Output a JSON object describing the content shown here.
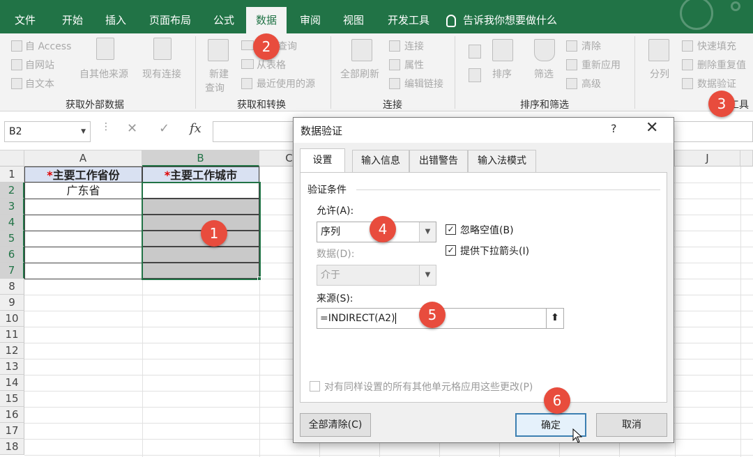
{
  "tabs": [
    "文件",
    "开始",
    "插入",
    "页面布局",
    "公式",
    "数据",
    "审阅",
    "视图",
    "开发工具"
  ],
  "tell_me": "告诉我你想要做什么",
  "ribbon": {
    "get_external": {
      "access": "自 Access",
      "web": "自网站",
      "text": "自文本",
      "other": "自其他来源",
      "existing": "现有连接",
      "group": "获取外部数据"
    },
    "get_transform": {
      "new_query": "新建",
      "new_query2": "查询",
      "show_queries": "查询",
      "from_table": "从表格",
      "recent": "最近使用的源",
      "group": "获取和转换"
    },
    "connections": {
      "refresh_all": "全部刷新",
      "connections": "连接",
      "properties": "属性",
      "edit_links": "编辑链接",
      "group": "连接"
    },
    "sort_filter": {
      "sort": "排序",
      "filter": "筛选",
      "clear": "清除",
      "reapply": "重新应用",
      "advanced": "高级",
      "group": "排序和筛选"
    },
    "data_tools": {
      "split": "分列",
      "flash_fill": "快速填充",
      "remove_dup": "删除重复值",
      "validation": "数据验证",
      "group_partial": "工具"
    }
  },
  "formula_bar": {
    "name_box": "B2",
    "fx": "fx"
  },
  "columns": [
    "A",
    "B",
    "C",
    "J"
  ],
  "rows": [
    "1",
    "2",
    "3",
    "4",
    "5",
    "6",
    "7",
    "8",
    "9",
    "10",
    "11",
    "12",
    "13",
    "14",
    "15",
    "16",
    "17",
    "18"
  ],
  "sheet": {
    "a1_star": "*",
    "a1": "主要工作省份",
    "b1_star": "*",
    "b1": "主要工作城市",
    "a2": "广东省"
  },
  "dialog": {
    "title": "数据验证",
    "help": "?",
    "close": "✕",
    "tabs": [
      "设置",
      "输入信息",
      "出错警告",
      "输入法模式"
    ],
    "criteria_label": "验证条件",
    "allow_label": "允许(A):",
    "allow_value": "序列",
    "data_label": "数据(D):",
    "data_value": "介于",
    "ignore_blank": "忽略空值(B)",
    "dropdown": "提供下拉箭头(I)",
    "source_label": "来源(S):",
    "source_value": "=INDIRECT(A2)",
    "apply_all": "对有同样设置的所有其他单元格应用这些更改(P)",
    "clear_all": "全部清除(C)",
    "ok": "确定",
    "cancel": "取消"
  },
  "badges": [
    "1",
    "2",
    "3",
    "4",
    "5",
    "6"
  ],
  "colors": {
    "excel_green": "#217346",
    "badge_red": "#e84c3d",
    "header_fill": "#d9e1f2",
    "selection_fill": "#c9c9c9"
  }
}
